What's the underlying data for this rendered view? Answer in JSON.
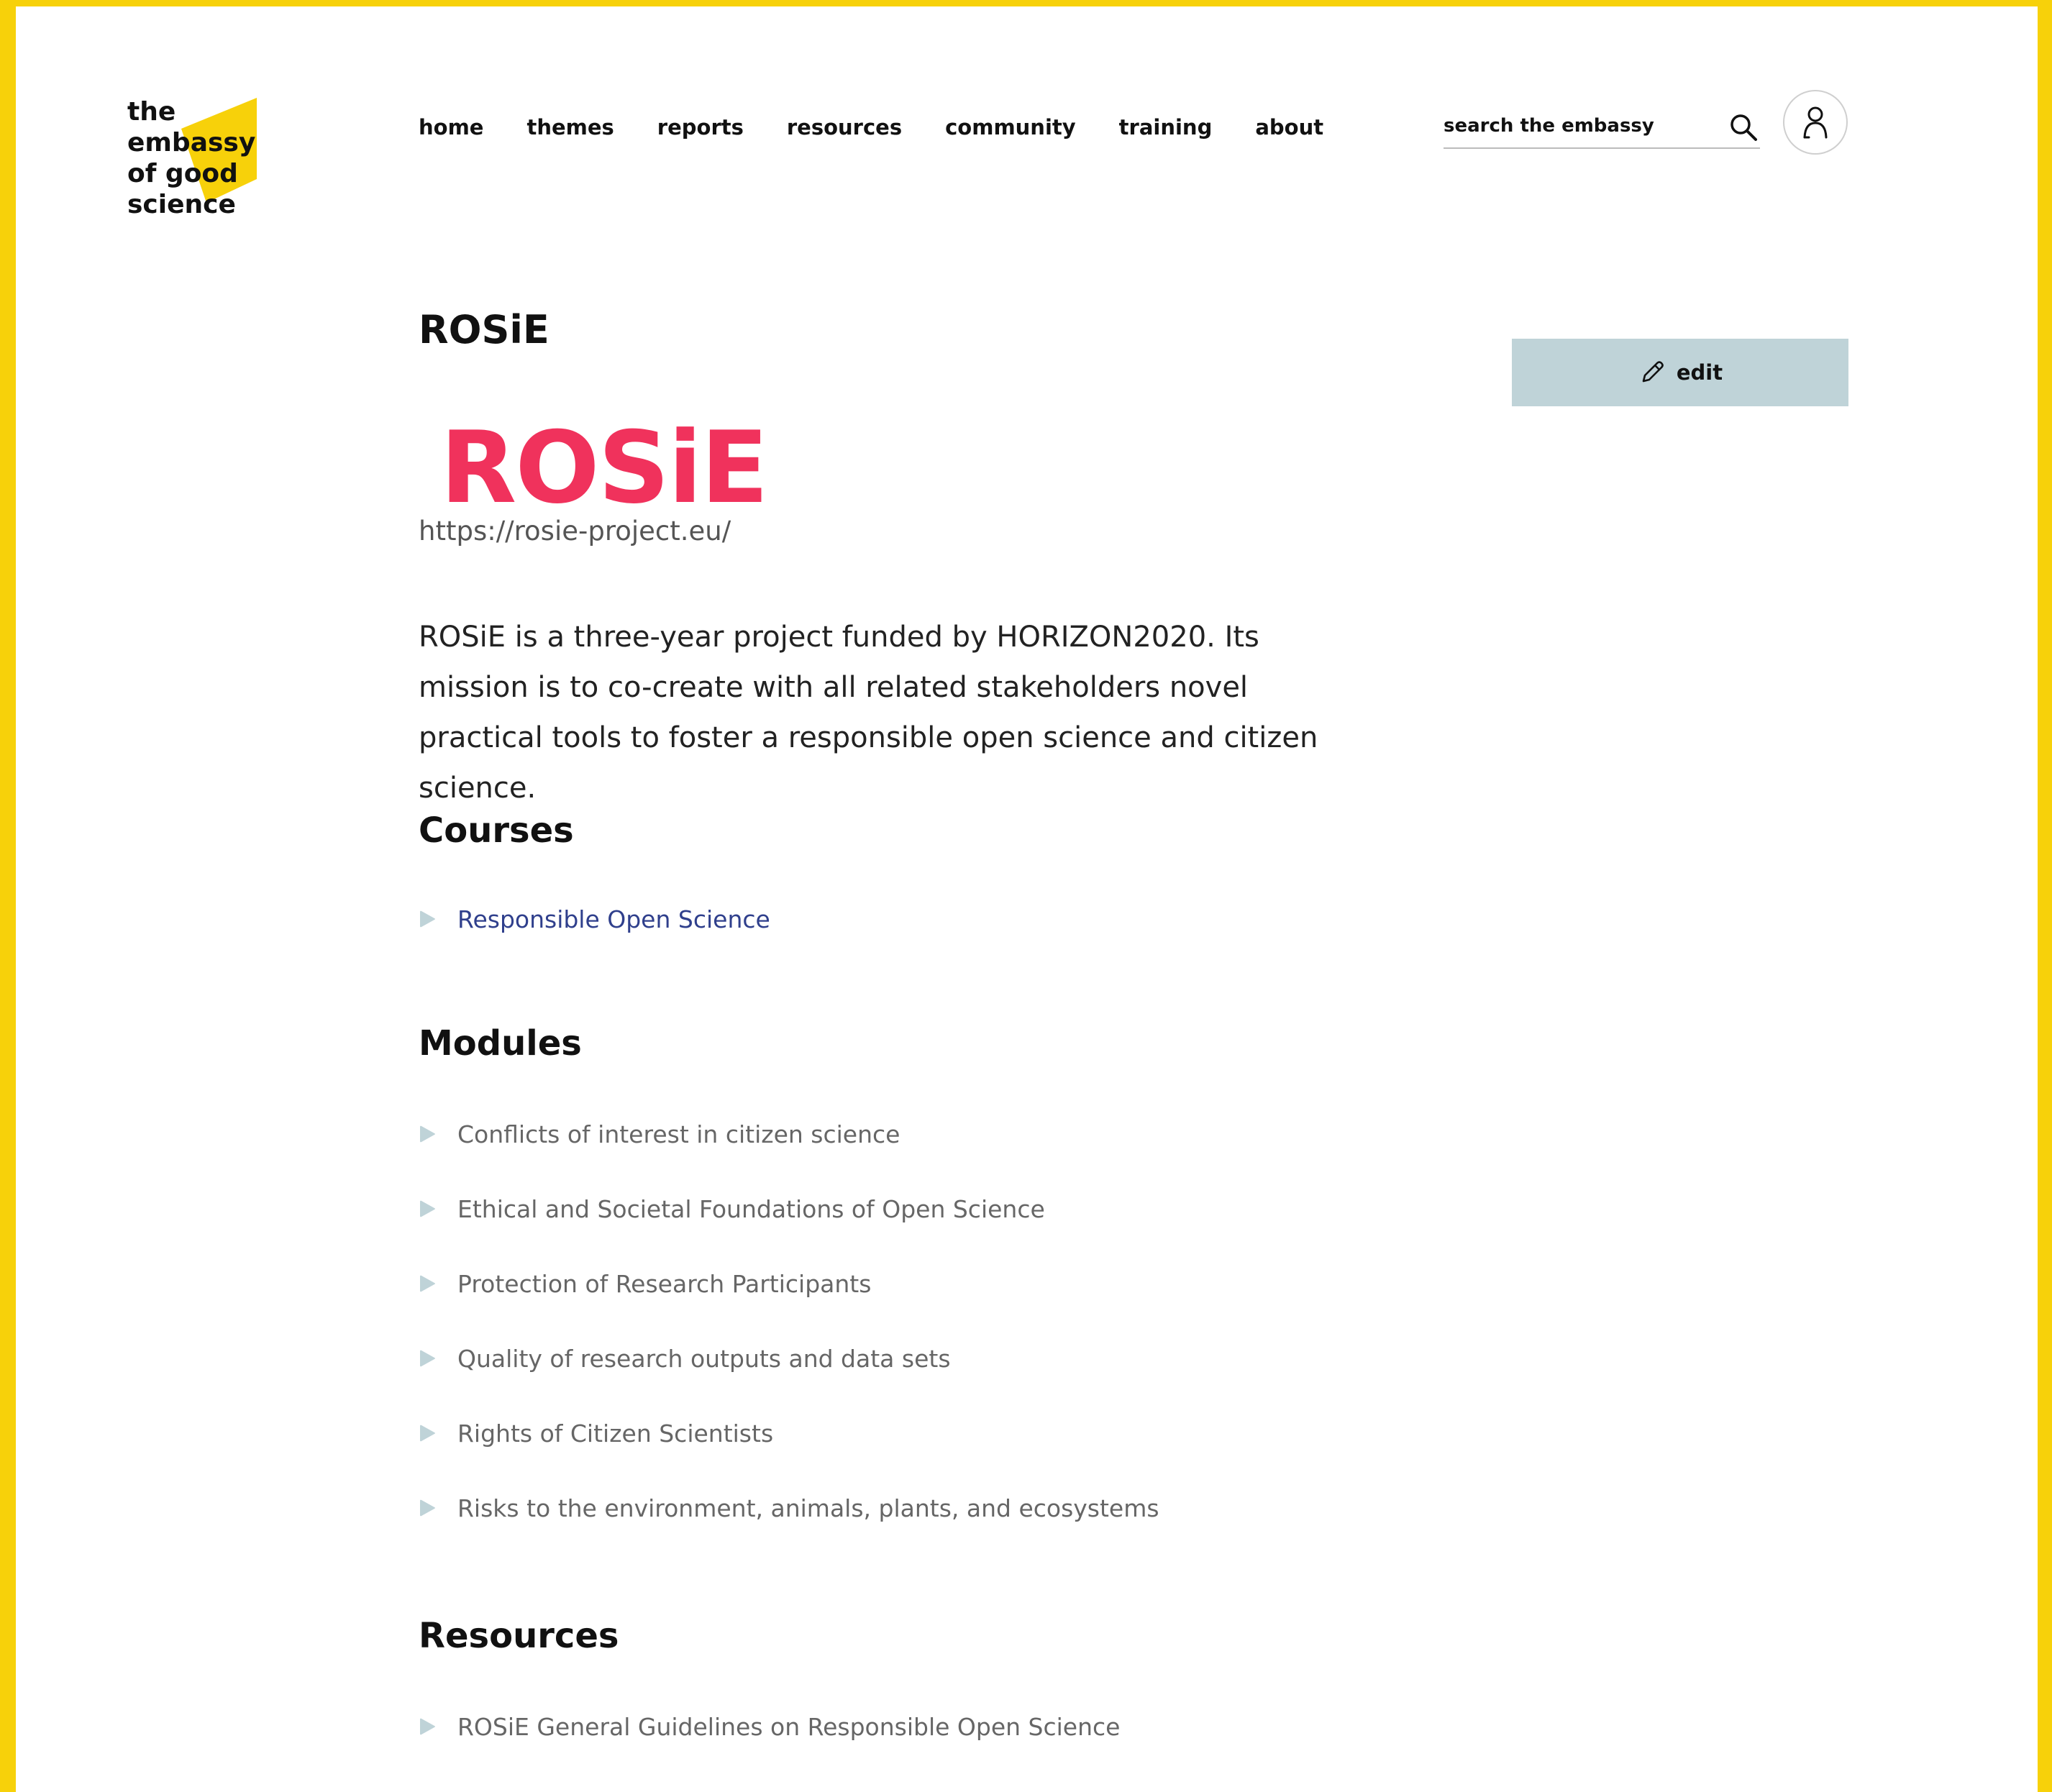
{
  "site": {
    "logo_lines": [
      "the",
      "embassy",
      "of good",
      "science"
    ],
    "accent_color": "#f7d10a"
  },
  "nav": {
    "items": [
      {
        "label": "home"
      },
      {
        "label": "themes"
      },
      {
        "label": "reports"
      },
      {
        "label": "resources"
      },
      {
        "label": "community"
      },
      {
        "label": "training"
      },
      {
        "label": "about"
      }
    ]
  },
  "search": {
    "placeholder": "search the embassy",
    "icon": "search-icon"
  },
  "account": {
    "icon": "user-icon"
  },
  "page": {
    "title": "ROSiE",
    "edit_label": "edit",
    "edit_icon": "pencil-icon",
    "edit_button_color": "#bfd3d8",
    "project_logo_text": "ROSiE",
    "project_logo_color": "#f0325c",
    "url": "https://rosie-project.eu/",
    "description": "ROSiE is a three-year project funded by HORIZON2020. Its mission is to co-create with all related stakeholders novel practical tools to foster a responsible open science and citizen science."
  },
  "courses": {
    "heading": "Courses",
    "items": [
      {
        "label": "Responsible Open Science"
      }
    ]
  },
  "modules": {
    "heading": "Modules",
    "items": [
      {
        "label": "Conflicts of interest in citizen science"
      },
      {
        "label": "Ethical and Societal Foundations of Open Science"
      },
      {
        "label": "Protection of Research Participants"
      },
      {
        "label": "Quality of research outputs and data sets"
      },
      {
        "label": "Rights of Citizen Scientists"
      },
      {
        "label": "Risks to the environment, animals, plants, and ecosystems"
      }
    ]
  },
  "resources": {
    "heading": "Resources",
    "items": [
      {
        "label": "ROSiE General Guidelines on Responsible Open Science"
      }
    ]
  }
}
